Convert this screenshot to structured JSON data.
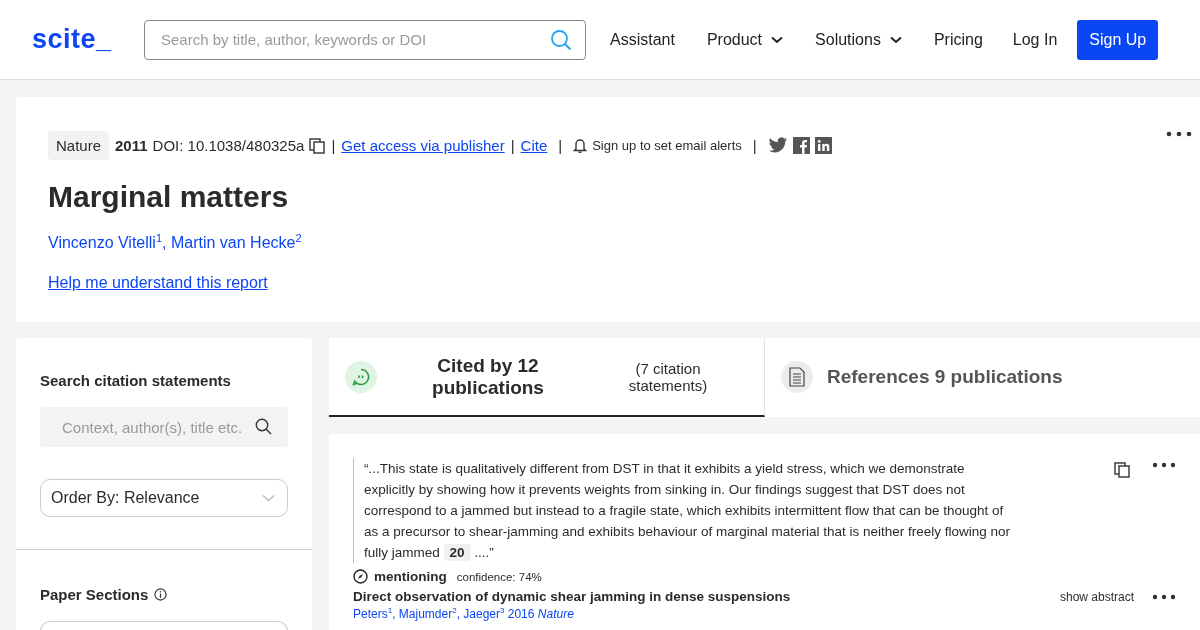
{
  "header": {
    "logo": "scite_",
    "search": {
      "placeholder": "Search by title, author, keywords or DOI"
    },
    "nav": [
      {
        "label": "Assistant",
        "dropdown": false
      },
      {
        "label": "Product",
        "dropdown": true
      },
      {
        "label": "Solutions",
        "dropdown": true
      },
      {
        "label": "Pricing",
        "dropdown": false
      },
      {
        "label": "Log In",
        "dropdown": false
      }
    ],
    "signup": "Sign Up"
  },
  "paper": {
    "venue": "Nature",
    "year": "2011",
    "doi": "DOI: 10.1038/480325a",
    "separators": [
      "|",
      "|",
      "|",
      "|"
    ],
    "access_link": "Get access via publisher",
    "cite_link": "Cite",
    "alerts": "Sign up to set email alerts",
    "title": "Marginal matters",
    "authors": "Vincenzo Vitelli$^{1}$, Martin van Hecke$^{2}$",
    "help_link": "Help me understand this report"
  },
  "sidebar": {
    "search_heading": "Search citation statements",
    "search": {
      "placeholder": "Context, author(s), title etc."
    },
    "order": "Order By: Relevance",
    "sections_heading": "Paper Sections"
  },
  "tabs": [
    {
      "label": "Cited by 12 publications",
      "sub": "(7 citation statements)",
      "selected": true,
      "kind": "cited"
    },
    {
      "label": "References 9 publications",
      "selected": false,
      "kind": "references"
    }
  ],
  "citation": {
    "quote_before": "“...This state is qualitatively different from DST in that it exhibits a yield stress, which we demonstrate explicitly by showing how it prevents weights from sinking in. Our findings suggest that DST does not correspond to a jammed but instead to a fragile state, which exhibits intermittent flow that can be thought of as a precursor to shear-jamming and exhibits behaviour of marginal material that is neither freely flowing nor fully jammed",
    "ref": "20",
    "quote_after": "....”",
    "type": "mentioning",
    "confidence": "confidence: 74%",
    "title": "Direct observation of dynamic shear jamming in dense suspensions",
    "show_abstract": "show abstract",
    "source": "Peters$^{1}$, Majumder$^{2}$, Jaeger$^{3}$ 2016 *Nature*"
  }
}
